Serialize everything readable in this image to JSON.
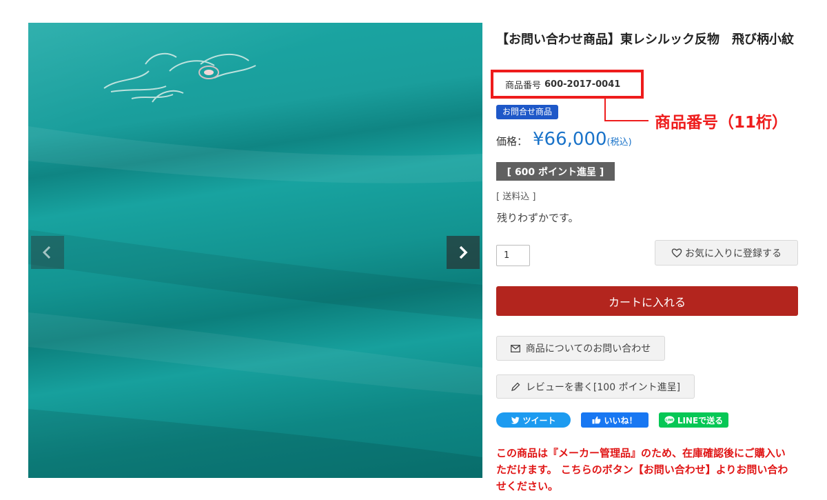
{
  "product": {
    "title": "【お問い合わせ商品】東レシルック反物　飛び柄小紋",
    "code_label": "商品番号",
    "code_value": "600-2017-0041",
    "inquiry_badge": "お問合せ商品",
    "price_label": "価格：",
    "price_value": "¥66,000",
    "price_tax": "(税込)",
    "points_badge": "[ 600 ポイント進呈 ]",
    "shipping": "[ 送料込 ]",
    "stock": "残りわずかです。",
    "quantity": "1"
  },
  "annotation": {
    "text": "商品番号（11桁）",
    "color": "#ee1c1c"
  },
  "actions": {
    "favorite_label": "お気に入りに登録する",
    "cart_label": "カートに入れる",
    "inquiry_label": "商品についてのお問い合わせ",
    "review_label": "レビューを書く[100 ポイント進呈]"
  },
  "sns": {
    "tweet": "ツイート",
    "like": "いいね！",
    "line": "LINEで送る"
  },
  "notice": "この商品は『メーカー管理品』のため、在庫確認後にご購入いただけます。 こちらのボタン【お問い合わせ】よりお問い合わせください。",
  "colors": {
    "price": "#1a73c9",
    "cart_button": "#b3251e",
    "inquiry_badge": "#1e58c8",
    "notice": "#e01515"
  },
  "icons": [
    "chevron-left-icon",
    "chevron-right-icon",
    "heart-icon",
    "mail-icon",
    "pencil-icon",
    "twitter-bird-icon",
    "thumbs-up-icon",
    "line-chat-icon"
  ]
}
